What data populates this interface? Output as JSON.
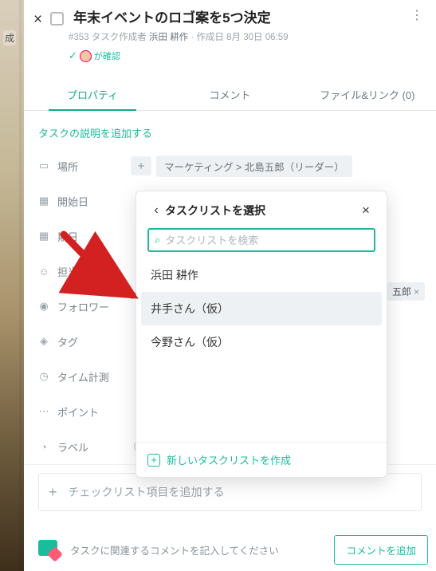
{
  "bg": {
    "sidebar_hint": "成"
  },
  "header": {
    "title": "年末イベントのロゴ案を5つ決定",
    "task_number": "#353",
    "creator_prefix": "タスク作成者",
    "creator_name": "浜田 耕作",
    "created_prefix": "作成日",
    "created_value": "8月 30日 06:59",
    "confirm_label": "が確認"
  },
  "tabs": {
    "properties": "プロパティ",
    "comments": "コメント",
    "files": "ファイル&リンク (0)"
  },
  "body": {
    "add_description": "タスクの説明を追加する",
    "location_label": "場所",
    "location_breadcrumb": "マーケティング > 北島五郎（リーダー）",
    "start_label": "開始日",
    "due_label": "期日",
    "assignee_label": "担当者",
    "follower_label": "フォロワー",
    "tag_label": "タグ",
    "time_label": "タイム計測",
    "points_label": "ポイント",
    "label_label": "ラベル",
    "checklist_placeholder": "チェックリスト項目を追加する",
    "partial_chip_text": "五郎"
  },
  "assignees": [
    {
      "name": "浜田 耕作",
      "color": "#f0b060"
    },
    {
      "name": "北島五郎",
      "color": "#7fd3c4"
    }
  ],
  "footer": {
    "hint": "タスクに関連するコメントを記入してください",
    "button": "コメントを追加"
  },
  "popover": {
    "title": "タスクリストを選択",
    "search_placeholder": "タスクリストを検索",
    "items": [
      "浜田 耕作",
      "井手さん（仮）",
      "今野さん（仮）"
    ],
    "highlighted_index": 1,
    "create_new": "新しいタスクリストを作成"
  },
  "label_colors": [
    "#d9d9d9",
    "#f8b4d9",
    "#f5b0b0",
    "#f7d59a",
    "#fff0a6",
    "#bce8c4",
    "#a8e3d7",
    "#a9d1f2",
    "#c7b9f2",
    "#ff7a1a",
    "#c9a47a",
    "#f2a6d4"
  ]
}
